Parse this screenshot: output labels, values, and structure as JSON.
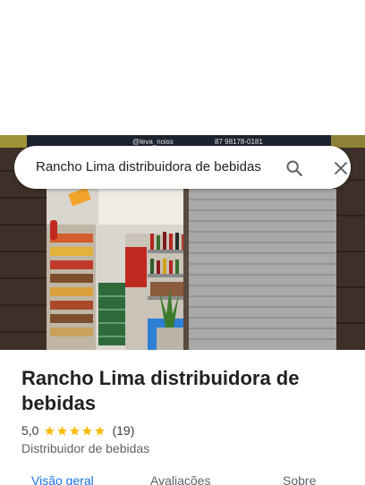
{
  "photo": {
    "sign_text_left": "@leva_noiss",
    "sign_text_right": "87 98178-0181"
  },
  "search": {
    "value": "Rancho Lima distribuidora de bebidas"
  },
  "place": {
    "title": "Rancho Lima distribuidora de bebidas",
    "rating": "5,0",
    "stars": 5,
    "review_count": "(19)",
    "category": "Distribuidor de bebidas"
  },
  "tabs": [
    {
      "label": "Visão geral",
      "active": true
    },
    {
      "label": "Avaliações",
      "active": false
    },
    {
      "label": "Sobre",
      "active": false
    }
  ],
  "colors": {
    "accent": "#1a73e8",
    "star": "#fbbc04"
  }
}
